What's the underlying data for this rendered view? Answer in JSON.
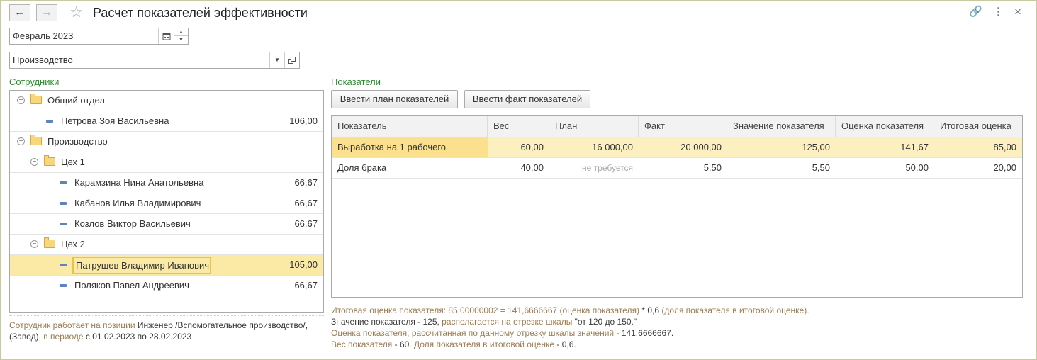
{
  "header": {
    "title": "Расчет показателей эффективности",
    "back_label": "←",
    "forward_label": "→",
    "star_label": "☆",
    "link_label": "🔗",
    "more_label": "⋮",
    "close_label": "×"
  },
  "period": {
    "value": "Февраль 2023",
    "calendar_icon": "calendar-icon"
  },
  "department": {
    "value": "Производство"
  },
  "employees": {
    "label": "Сотрудники",
    "rows": [
      {
        "type": "group",
        "label": "Общий отдел",
        "value": ""
      },
      {
        "type": "item",
        "label": "Петрова Зоя Васильевна",
        "value": "106,00"
      },
      {
        "type": "group",
        "label": "Производство",
        "value": ""
      },
      {
        "type": "group",
        "label": "Цех 1",
        "value": ""
      },
      {
        "type": "item",
        "label": "Карамзина Нина Анатольевна",
        "value": "66,67"
      },
      {
        "type": "item",
        "label": "Кабанов Илья Владимирович",
        "value": "66,67"
      },
      {
        "type": "item",
        "label": "Козлов Виктор Васильевич",
        "value": "66,67"
      },
      {
        "type": "group",
        "label": "Цех 2",
        "value": ""
      },
      {
        "type": "item",
        "label": "Патрушев Владимир Иванович",
        "value": "105,00"
      },
      {
        "type": "item",
        "label": "Поляков Павел Андреевич",
        "value": "66,67"
      }
    ]
  },
  "employee_info": {
    "p1": "Сотрудник работает на позиции",
    "p2": " Инженер /Вспомогательное производство/, (Завод),",
    "p3": " в периоде",
    "p4": " с 01.02.2023 по 28.02.2023"
  },
  "indicators": {
    "label": "Показатели",
    "plan_button": "Ввести план показателей",
    "fact_button": "Ввести факт показателей",
    "columns": [
      "Показатель",
      "Вес",
      "План",
      "Факт",
      "Значение показателя",
      "Оценка показателя",
      "Итоговая оценка"
    ],
    "rows": [
      [
        "Выработка на 1 рабочего",
        "60,00",
        "16 000,00",
        "20 000,00",
        "125,00",
        "141,67",
        "85,00"
      ],
      [
        "Доля брака",
        "40,00",
        "не требуется",
        "5,50",
        "5,50",
        "50,00",
        "20,00"
      ]
    ]
  },
  "notes": {
    "n1a": "Итоговая оценка показателя: 85,00000002 = 141,6666667",
    "n1b": " (оценка показателя)",
    "n1c": " * 0,6",
    "n1d": " (доля показателя в итоговой оценке).",
    "n2a": "Значение показателя - 125,",
    "n2b": " располагается на отрезке шкалы",
    "n2c": " \"от 120 до 150.\"",
    "n3a": "Оценка показателя, рассчитанная по данному отрезку шкалы значений",
    "n3b": " - 141,6666667.",
    "n4a": "Вес показателя",
    "n4b": " - 60.",
    "n4c": " Доля показателя в итоговой оценке",
    "n4d": " - 0,6."
  },
  "colors": {
    "accent_green": "#2e8b2e",
    "selection": "#fbe9a6",
    "selection_border": "#e8c34a",
    "note_brown": "#9b7b52"
  }
}
